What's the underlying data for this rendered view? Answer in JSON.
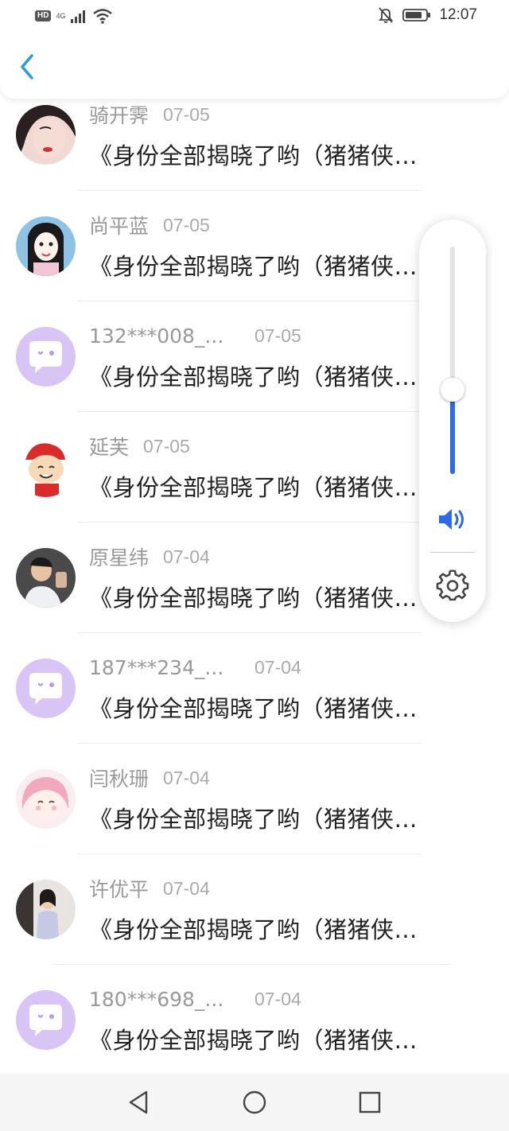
{
  "status_bar": {
    "hd_label": "HD",
    "network_label": "4G",
    "time": "12:07",
    "icons": [
      "hd-icon",
      "signal-icon",
      "wifi-icon",
      "mute-bell-icon",
      "battery-icon"
    ]
  },
  "header": {
    "back_icon": "chevron-left-icon"
  },
  "comments": [
    {
      "username": "骑开霁",
      "date": "07-05",
      "message": "《身份全部揭晓了哟（猪猪侠…",
      "avatar": "photo"
    },
    {
      "username": "尚平蓝",
      "date": "07-05",
      "message": "《身份全部揭晓了哟（猪猪侠…",
      "avatar": "photo"
    },
    {
      "username": "132***008_...",
      "date": "07-05",
      "message": "《身份全部揭晓了哟（猪猪侠…",
      "avatar": "default"
    },
    {
      "username": "延芙",
      "date": "07-05",
      "message": "《身份全部揭晓了哟（猪猪侠…",
      "avatar": "photo"
    },
    {
      "username": "原星纬",
      "date": "07-04",
      "message": "《身份全部揭晓了哟（猪猪侠…",
      "avatar": "photo"
    },
    {
      "username": "187***234_...",
      "date": "07-04",
      "message": "《身份全部揭晓了哟（猪猪侠…",
      "avatar": "default"
    },
    {
      "username": "闫秋珊",
      "date": "07-04",
      "message": "《身份全部揭晓了哟（猪猪侠…",
      "avatar": "photo"
    },
    {
      "username": "许优平",
      "date": "07-04",
      "message": "《身份全部揭晓了哟（猪猪侠…",
      "avatar": "photo"
    },
    {
      "username": "180***698_...",
      "date": "07-04",
      "message": "《身份全部揭晓了哟（猪猪侠…",
      "avatar": "default"
    }
  ],
  "volume_panel": {
    "level": 0.37,
    "accent_color": "#2f6ae6",
    "volume_icon": "speaker-icon",
    "settings_icon": "gear-icon"
  },
  "nav_bar": {
    "icons": [
      "back-triangle-icon",
      "home-circle-icon",
      "recents-square-icon"
    ]
  }
}
